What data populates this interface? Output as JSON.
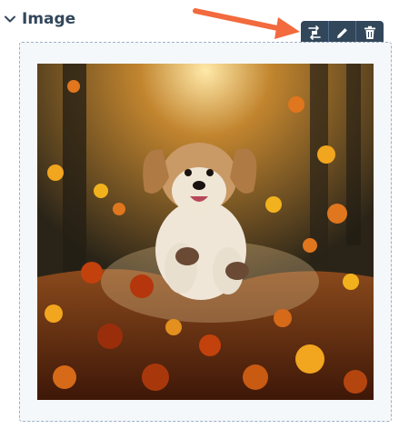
{
  "section": {
    "title": "Image",
    "expanded": true,
    "toggle_icon": "chevron-down-icon"
  },
  "toolbar": {
    "buttons": [
      {
        "id": "replace",
        "icon": "replace-image-icon"
      },
      {
        "id": "edit",
        "icon": "pencil-icon"
      },
      {
        "id": "delete",
        "icon": "trash-icon"
      }
    ]
  },
  "annotation": {
    "icon": "arrow-icon",
    "color": "#f26a3d"
  },
  "colors": {
    "title": "#33475b",
    "toolbar_bg": "#33475b",
    "panel_bg": "#f5f8fa",
    "panel_border": "#9fb0c4"
  }
}
